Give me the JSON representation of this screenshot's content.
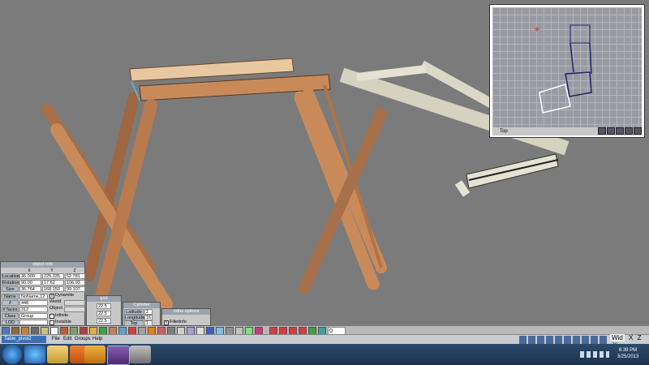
{
  "scene": {
    "background": "#7b7b7b",
    "wood_color": "#c98a5a",
    "selected_color": "#e6e2d2"
  },
  "top_view": {
    "label": "Top"
  },
  "object_info": {
    "title": "object info",
    "headers": [
      "X",
      "Y",
      "Z"
    ],
    "rows": [
      {
        "label": "Location",
        "values": [
          "36.000",
          "225.335",
          "52.781"
        ]
      },
      {
        "label": "Rotation",
        "values": [
          "90.00",
          "17.62",
          "106.93"
        ]
      },
      {
        "label": "Size",
        "values": [
          "36.764",
          "168.150",
          "99.107"
        ]
      }
    ],
    "name_label": "Name",
    "name_value": "NoName,12",
    "dynamite_label": "Dynamite",
    "vertices_label": "# vertices",
    "vertices_value": "448",
    "world_label": "World",
    "faces_label": "# faces",
    "faces_value": "312",
    "object_label": "Object",
    "class_label": "Class",
    "class_value": "Group",
    "infinite_label": "Infinite",
    "lod_label": "LOD Dist",
    "invisible_label": "Invisible"
  },
  "grid": {
    "title": "grid",
    "values": [
      "22.5",
      "22.5",
      "22.5"
    ]
  },
  "cylinder": {
    "title": "Cylinder",
    "latitude_label": "Latitude",
    "latitude_value": "2",
    "longitude_label": "Longitude",
    "longitude_value": "16",
    "top_radius_label": "Top Radius",
    "top_radius_value": "1"
  },
  "ortho": {
    "title": "ortho options",
    "fillet_label": "FilletInfo"
  },
  "toolstrip": {
    "frame_value": "0"
  },
  "appbar": {
    "file_tab": "Table_pivot2",
    "menus": [
      "File",
      "Edit",
      "Groups",
      "Help"
    ],
    "wid": "Wid",
    "window_controls": [
      "X",
      "Z",
      "Y"
    ]
  },
  "taskbar": {
    "time": "6:39 PM",
    "date": "3/25/2013"
  }
}
